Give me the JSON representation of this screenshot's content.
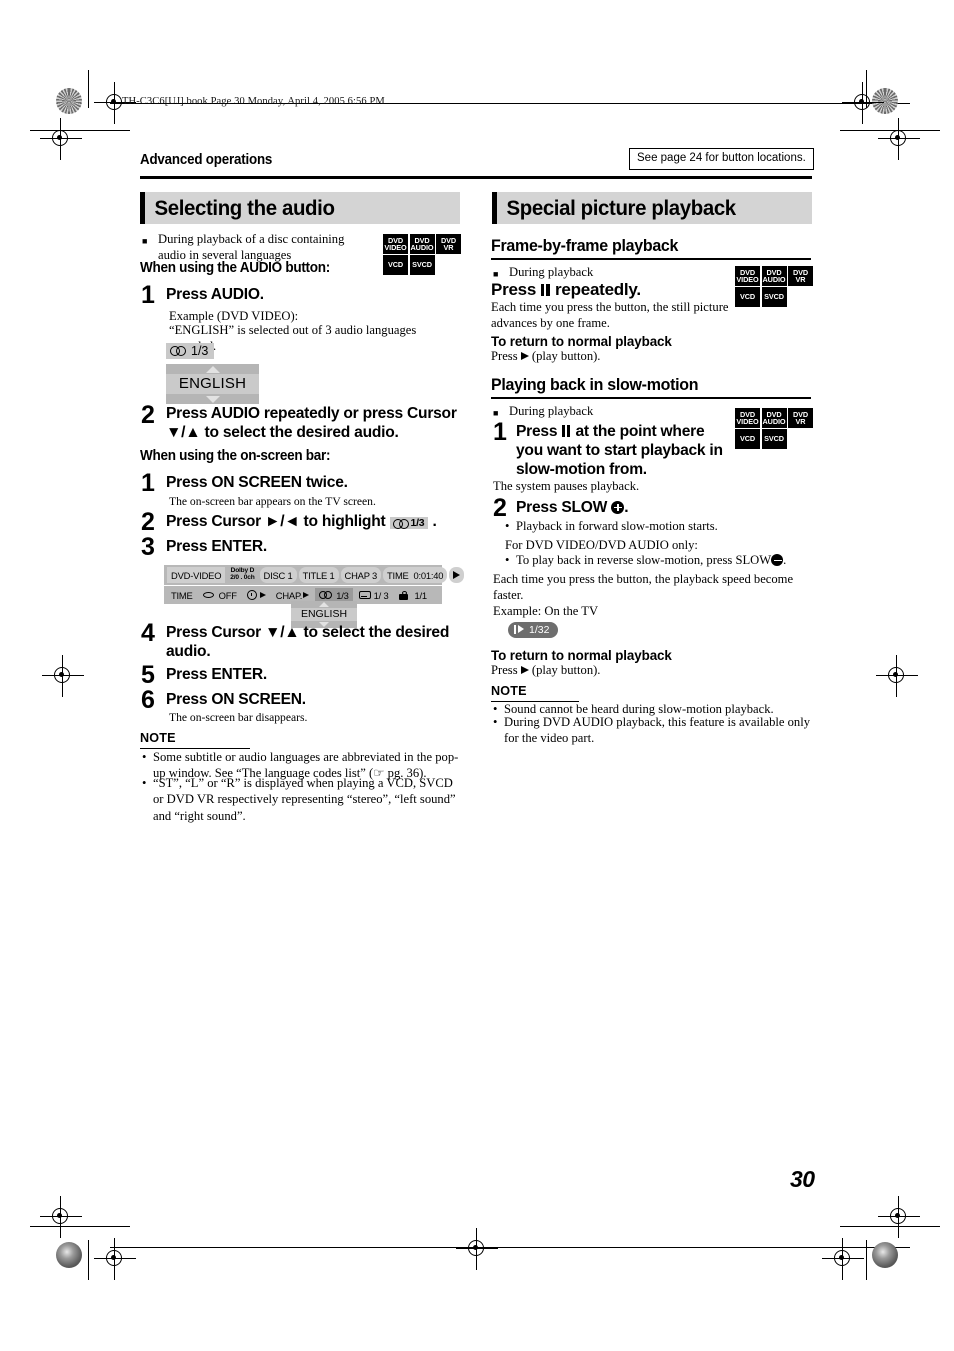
{
  "running_header": "TH-C3C6[UJ].book  Page 30  Monday, April 4, 2005  6:56 PM",
  "page_number": "30",
  "top": {
    "section_label": "Advanced operations",
    "reference_note": "See page 24 for button locations."
  },
  "left_column": {
    "title": "Selecting the audio",
    "intro_bullet": "During playback of a disc containing audio in several languages",
    "badges": {
      "row1": [
        {
          "line1": "DVD",
          "line2": "VIDEO"
        },
        {
          "line1": "DVD",
          "line2": "AUDIO"
        },
        {
          "line1": "DVD",
          "line2": "VR"
        }
      ],
      "row2": [
        {
          "line1": "VCD"
        },
        {
          "line1": "SVCD"
        }
      ]
    },
    "subhead_audio_button": "When using the AUDIO button:",
    "step1_num": "1",
    "step1_text": "Press AUDIO.",
    "step1_desc_line1": "Example (DVD VIDEO):",
    "step1_desc_line2": "“ENGLISH” is selected out of 3 audio languages recorded.",
    "popup_chip_value": "1/3",
    "popup_language": "ENGLISH",
    "step2_num": "2",
    "step2_text": "Press AUDIO repeatedly or press Cursor ▼/▲ to select the desired audio.",
    "subhead_onscreen_bar": "When using the on-screen bar:",
    "osb_step1_num": "1",
    "osb_step1_text": "Press ON SCREEN twice.",
    "osb_step1_desc": "The on-screen bar appears on the TV screen.",
    "osb_step2_num": "2",
    "osb_step2_text_a": "Press Cursor ►/◄ to highlight",
    "osb_step2_chip": "1/3",
    "osb_step2_text_b": ".",
    "osb_step3_num": "3",
    "osb_step3_text": "Press ENTER.",
    "onscreen_bar": {
      "disc_type": "DVD-VIDEO",
      "dolby_line1": "Dolby D",
      "dolby_line2": "2/0 . 0ch",
      "disc": "DISC 1",
      "title": "TITLE 1",
      "chapter": "CHAP  3",
      "time_label": "TIME",
      "time_value": "0:01:40",
      "row2_time": "TIME",
      "row2_repeat": "OFF",
      "row2_chap": "CHAP.",
      "audio_value": "1/3",
      "subtitle_value": "1/ 3",
      "angle_value": "1/1",
      "popup_language": "ENGLISH"
    },
    "osb_step4_num": "4",
    "osb_step4_text": "Press Cursor ▼/▲ to select the desired audio.",
    "osb_step5_num": "5",
    "osb_step5_text": "Press ENTER.",
    "osb_step6_num": "6",
    "osb_step6_text": "Press ON SCREEN.",
    "osb_step6_desc": "The on-screen bar disappears.",
    "note_title": "NOTE",
    "notes": [
      "Some subtitle or audio languages are abbreviated in the pop-up window. See “The language codes list” (☞ pg. 36).",
      "“ST”, “L” or “R” is displayed when playing a VCD, SVCD or DVD VR respectively representing “stereo”, “left sound” and “right sound”."
    ]
  },
  "right_column": {
    "title": "Special picture playback",
    "frame_section": {
      "heading": "Frame-by-frame playback",
      "intro_bullet": "During playback",
      "press_text_a": "Press",
      "press_text_b": "repeatedly.",
      "desc": "Each time you press the button, the still picture advances by one frame.",
      "return_heading": "To return to normal playback",
      "return_text_a": "Press",
      "return_text_b": "(play button).",
      "badges": {
        "row1": [
          {
            "line1": "DVD",
            "line2": "VIDEO"
          },
          {
            "line1": "DVD",
            "line2": "AUDIO"
          },
          {
            "line1": "DVD",
            "line2": "VR"
          }
        ],
        "row2": [
          {
            "line1": "VCD"
          },
          {
            "line1": "SVCD"
          }
        ]
      }
    },
    "slow_section": {
      "heading": "Playing back in slow-motion",
      "intro_bullet": "During playback",
      "step1_num": "1",
      "step1_text_a": "Press",
      "step1_text_b": "at the point where you want to start playback in slow-motion from.",
      "step1_desc": "The system pauses playback.",
      "step2_num": "2",
      "step2_text_a": "Press SLOW",
      "step2_text_b": ".",
      "step2_bullet": "Playback in forward slow-motion starts.",
      "dvd_only_line": "For DVD VIDEO/DVD AUDIO only:",
      "reverse_bullet_a": "To play back in reverse slow-motion, press SLOW",
      "reverse_bullet_b": ".",
      "speed_desc": "Each time you press the button, the playback speed become faster.",
      "example_line": "Example: On the TV",
      "speed_chip": "1/32",
      "return_heading": "To return to normal playback",
      "return_text_a": "Press",
      "return_text_b": "(play button).",
      "note_title": "NOTE",
      "notes": [
        "Sound cannot be heard during slow-motion playback.",
        "During DVD AUDIO playback, this feature is available only for the video part."
      ],
      "badges": {
        "row1": [
          {
            "line1": "DVD",
            "line2": "VIDEO"
          },
          {
            "line1": "DVD",
            "line2": "AUDIO"
          },
          {
            "line1": "DVD",
            "line2": "VR"
          }
        ],
        "row2": [
          {
            "line1": "VCD"
          },
          {
            "line1": "SVCD"
          }
        ]
      }
    }
  },
  "colors": {
    "banner_bg": "#d4d4d4",
    "osd_bg": "#b8b8b8",
    "osd_cell": "#cfcfcf",
    "badge_bg": "#000000",
    "chip_dark": "#6e6e6e"
  }
}
